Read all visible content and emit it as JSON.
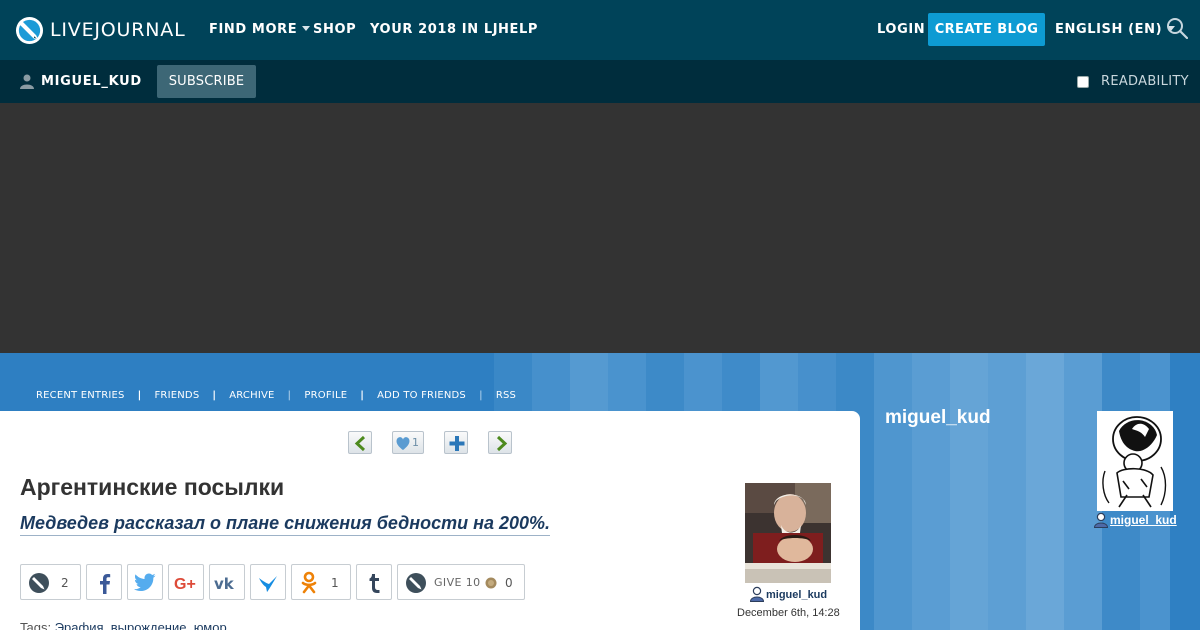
{
  "topbar": {
    "logo_text": "LIVEJOURNAL",
    "logo_icon": "livejournal-pen-icon",
    "nav": [
      {
        "label": "FIND MORE",
        "has_dropdown": true
      },
      {
        "label": "SHOP"
      },
      {
        "label": "YOUR 2018 IN LJ"
      },
      {
        "label": "HELP"
      }
    ],
    "login_label": "LOGIN",
    "create_blog_label": "CREATE BLOG",
    "language_label": "ENGLISH (EN)",
    "search_icon": "search-icon",
    "colors": {
      "background": "#004359",
      "accent": "#0d9bd3"
    }
  },
  "journalbar": {
    "username": "MIGUEL_KUD",
    "subscribe_label": "SUBSCRIBE",
    "readability_label": "READABILITY",
    "readability_checked": false
  },
  "journal_nav": [
    "RECENT ENTRIES",
    "FRIENDS",
    "ARCHIVE",
    "PROFILE",
    "ADD TO FRIENDS",
    "RSS"
  ],
  "post": {
    "controls": [
      "prev-entry-icon",
      "like-icon",
      "add-memories-icon",
      "next-entry-icon"
    ],
    "like_count": "1",
    "title": "Аргентинские посылки",
    "subtitle": "Медведев рассказал о плане снижения бедности на 200%.",
    "share": [
      {
        "icon": "livejournal-share-icon",
        "count": "2"
      },
      {
        "icon": "facebook-icon"
      },
      {
        "icon": "twitter-icon"
      },
      {
        "icon": "google-plus-icon"
      },
      {
        "icon": "vk-icon"
      },
      {
        "icon": "moimir-icon"
      },
      {
        "icon": "odnoklassniki-icon",
        "count": "1"
      },
      {
        "icon": "tumblr-icon"
      }
    ],
    "give": {
      "label": "GIVE 10",
      "count": "0"
    },
    "tags_label": "Tags:",
    "tags": "Эрафия, вырождение, юмор",
    "author": "miguel_kud",
    "date": "December 6th, 14:28"
  },
  "sidebar": {
    "journal_name": "miguel_kud",
    "user_link": "miguel_kud"
  }
}
